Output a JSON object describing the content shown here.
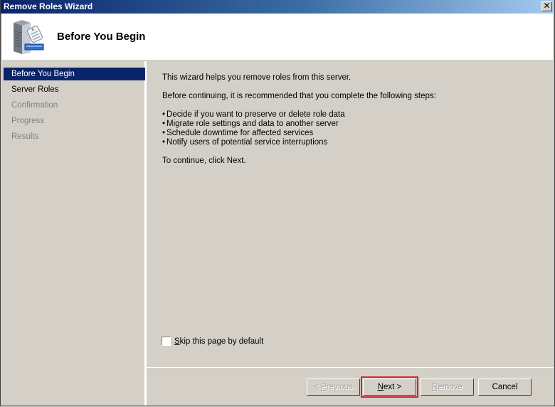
{
  "window": {
    "title": "Remove Roles Wizard",
    "close_label": "✕"
  },
  "header": {
    "heading": "Before You Begin",
    "icon": "server-role-icon"
  },
  "sidebar": {
    "items": [
      {
        "label": "Before You Begin",
        "state": "active"
      },
      {
        "label": "Server Roles",
        "state": "enabled"
      },
      {
        "label": "Confirmation",
        "state": "disabled"
      },
      {
        "label": "Progress",
        "state": "disabled"
      },
      {
        "label": "Results",
        "state": "disabled"
      }
    ]
  },
  "content": {
    "intro": "This wizard helps you remove roles from this server.",
    "recommend": "Before continuing, it is recommended that you complete the following steps:",
    "steps": [
      "Decide if you want to preserve or delete role data",
      "Migrate role settings and data to another server",
      "Schedule downtime for affected services",
      "Notify users of potential service interruptions"
    ],
    "continue": "To continue, click Next."
  },
  "skip_checkbox": {
    "label_accel": "S",
    "label_rest": "kip this page by default",
    "checked": false
  },
  "buttons": {
    "previous": {
      "prefix": "< ",
      "accel": "P",
      "rest": "revious",
      "enabled": false
    },
    "next": {
      "accel": "N",
      "rest": "ext >",
      "enabled": true,
      "highlighted": true
    },
    "remove": {
      "accel": "R",
      "rest": "emove",
      "enabled": false
    },
    "cancel": {
      "label": "Cancel",
      "enabled": true
    }
  },
  "colors": {
    "highlight": "#d9202a",
    "selection": "#0a246a"
  }
}
